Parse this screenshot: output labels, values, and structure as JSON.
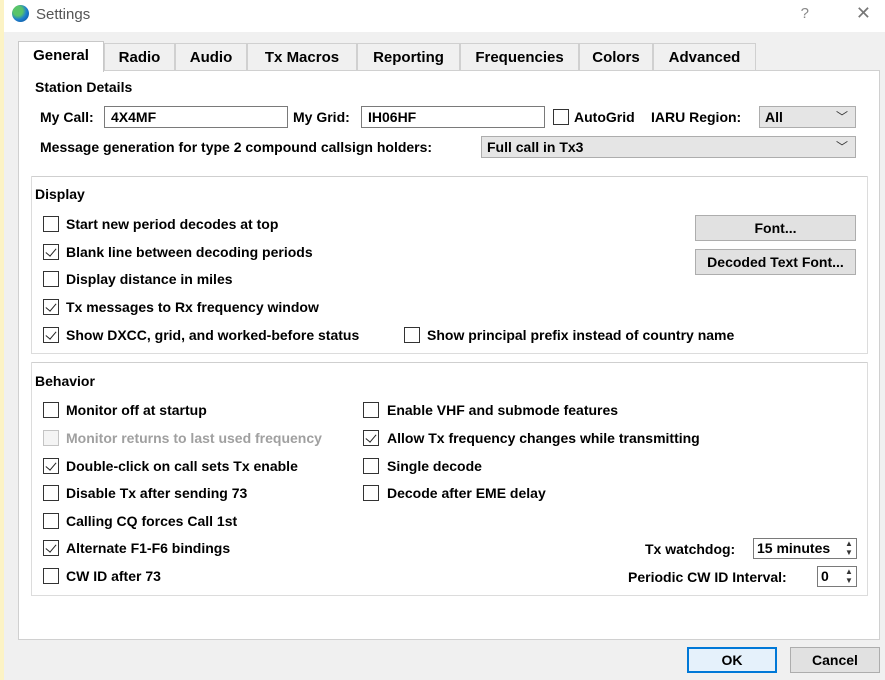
{
  "window": {
    "title": "Settings",
    "help": "?",
    "close": "✕"
  },
  "tabs": [
    "General",
    "Radio",
    "Audio",
    "Tx Macros",
    "Reporting",
    "Frequencies",
    "Colors",
    "Advanced"
  ],
  "station": {
    "title": "Station Details",
    "my_call_label": "My Call:",
    "my_call_value": "4X4MF",
    "my_grid_label": "My Grid:",
    "my_grid_value": "IH06HF",
    "autogrid_label": "AutoGrid",
    "autogrid_checked": false,
    "iaru_label": "IARU Region:",
    "iaru_value": "All",
    "msg_gen_label": "Message generation for type 2 compound callsign holders:",
    "msg_gen_value": "Full call in Tx3"
  },
  "display": {
    "title": "Display",
    "start_new_period": "Start new period decodes at top",
    "blank_line": "Blank line between decoding periods",
    "distance_miles": "Display distance in miles",
    "tx_to_rx": "Tx messages to Rx frequency window",
    "show_dxcc": "Show DXCC, grid, and worked-before status",
    "show_prefix": "Show principal prefix instead of country name",
    "font_button": "Font...",
    "decoded_font_button": "Decoded Text Font..."
  },
  "behavior": {
    "title": "Behavior",
    "monitor_off": "Monitor off at startup",
    "monitor_returns": "Monitor returns to last used frequency",
    "double_click": "Double-click on call sets Tx enable",
    "disable_tx": "Disable Tx after sending 73",
    "calling_cq": "Calling CQ forces Call 1st",
    "alt_bindings": "Alternate F1-F6 bindings",
    "cw_id": "CW ID after 73",
    "enable_vhf": "Enable VHF and submode features",
    "allow_tx_freq": "Allow Tx frequency changes while transmitting",
    "single_decode": "Single decode",
    "decode_eme": "Decode after EME delay",
    "tx_watchdog_label": "Tx watchdog:",
    "tx_watchdog_value": "15 minutes",
    "periodic_cw_label": "Periodic CW ID Interval:",
    "periodic_cw_value": "0"
  },
  "footer": {
    "ok": "OK",
    "cancel": "Cancel"
  },
  "colors": {
    "accent": "#0078d7",
    "app_bg": "#fcf3c5",
    "pane_bg": "#ffffff"
  }
}
